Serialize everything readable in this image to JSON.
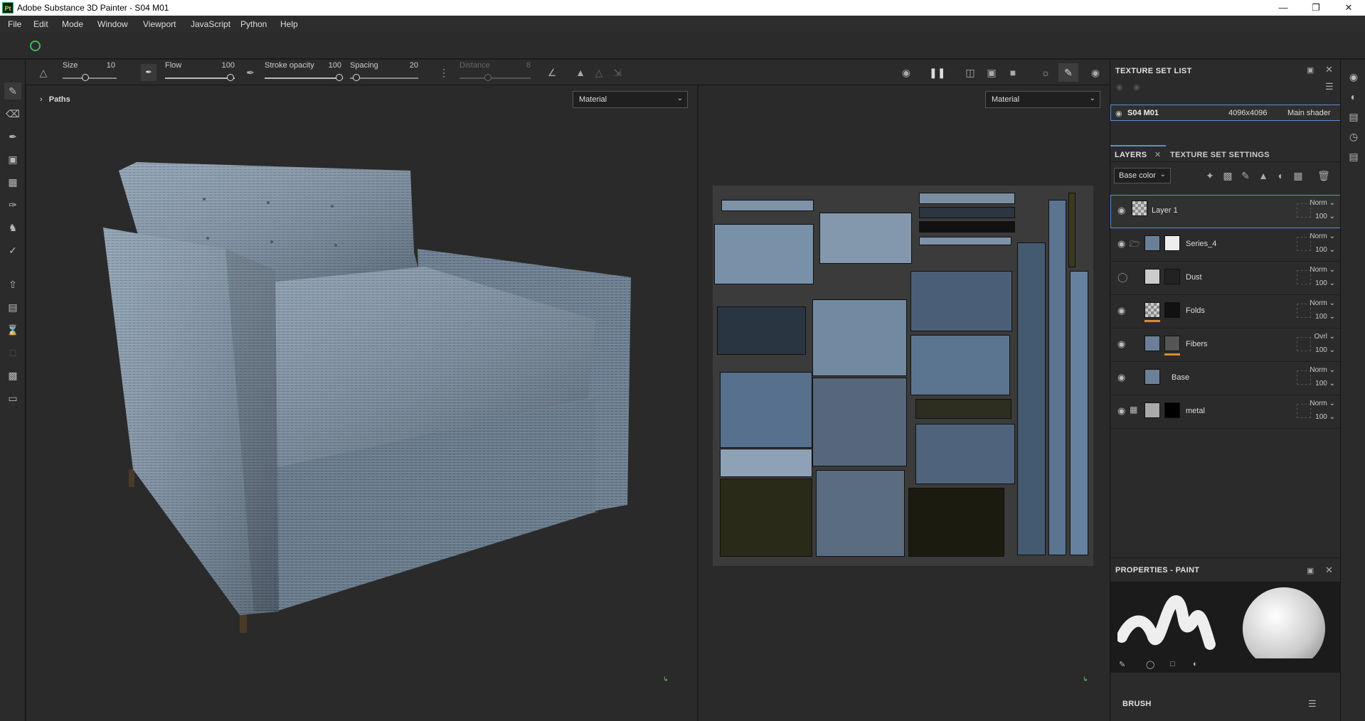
{
  "window": {
    "title": "Adobe Substance 3D Painter - S04 M01",
    "logo": "Pt"
  },
  "menu": [
    "File",
    "Edit",
    "Mode",
    "Window",
    "Viewport",
    "JavaScript",
    "Python",
    "Help"
  ],
  "toolbar": {
    "size_label": "Size",
    "size_value": "10",
    "flow_label": "Flow",
    "flow_value": "100",
    "stroke_opacity_label": "Stroke opacity",
    "stroke_opacity_value": "100",
    "spacing_label": "Spacing",
    "spacing_value": "20",
    "distance_label": "Distance",
    "distance_value": "8"
  },
  "viewport3d": {
    "paths_label": "Paths",
    "mode_select": "Material"
  },
  "viewport2d": {
    "mode_select": "Material"
  },
  "texture_set_list": {
    "title": "TEXTURE SET LIST",
    "item": {
      "name": "S04 M01",
      "resolution": "4096x4096",
      "shader": "Main shader"
    }
  },
  "layers_panel": {
    "tab_layers": "LAYERS",
    "tab_settings": "TEXTURE SET SETTINGS",
    "channel_select": "Base color",
    "layers": [
      {
        "name": "Layer 1",
        "blend": "Norm",
        "opacity": "100"
      },
      {
        "name": "Series_4",
        "blend": "Norm",
        "opacity": "100"
      },
      {
        "name": "Dust",
        "blend": "Norm",
        "opacity": "100"
      },
      {
        "name": "Folds",
        "blend": "Norm",
        "opacity": "100"
      },
      {
        "name": "Fibers",
        "blend": "Ovrl",
        "opacity": "100"
      },
      {
        "name": "Base",
        "blend": "Norm",
        "opacity": "100"
      },
      {
        "name": "metal",
        "blend": "Norm",
        "opacity": "100"
      }
    ]
  },
  "properties": {
    "title": "PROPERTIES - PAINT",
    "brush_label": "BRUSH"
  },
  "colors": {
    "accent": "#5b8fd0",
    "panel_bg": "#2b2b2b",
    "viewport_bg": "#2a2a2a",
    "orange_bar": "#e08a2c"
  }
}
